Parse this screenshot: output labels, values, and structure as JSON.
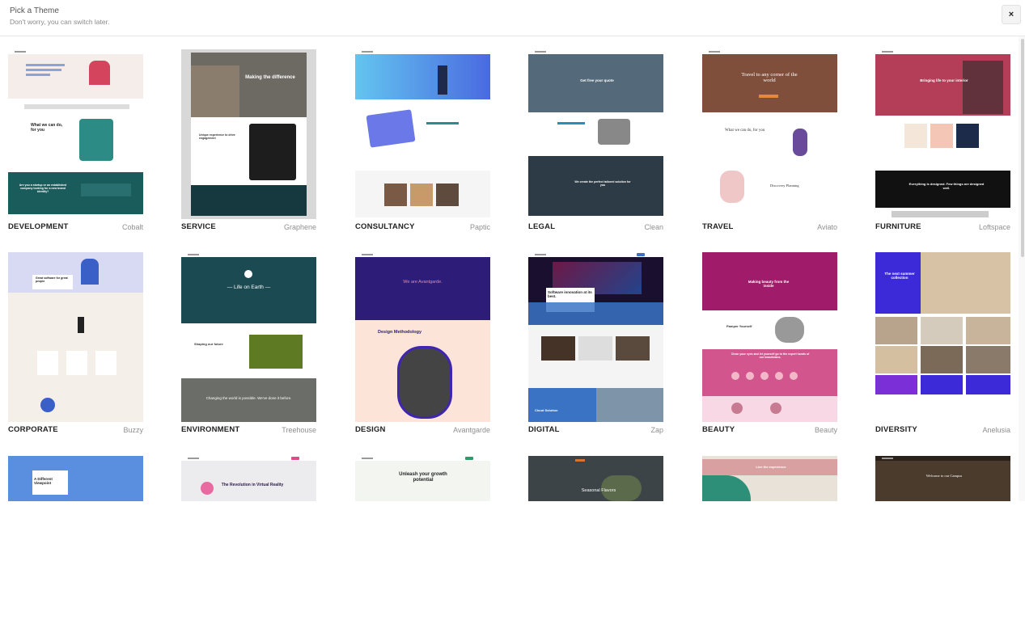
{
  "header": {
    "title": "Pick a Theme",
    "subtitle": "Don't worry, you can switch later.",
    "close_label": "×"
  },
  "themes": [
    {
      "category": "DEVELOPMENT",
      "name": "Cobalt",
      "headline": "What we can do, for you",
      "banner": "Are you a startup or an established company looking for a new brand identity?",
      "accent": "#1a5b5c"
    },
    {
      "category": "SERVICE",
      "name": "Graphene",
      "headline": "Making the difference",
      "banner": "Unique experience to drive engagement",
      "accent": "#16393f"
    },
    {
      "category": "CONSULTANCY",
      "name": "Paptic",
      "headline": "",
      "banner": "",
      "accent": "#3b6ee0"
    },
    {
      "category": "LEGAL",
      "name": "Clean",
      "headline": "Get free your quote",
      "banner": "We create the perfect tailored solution for you",
      "accent": "#2c3b46"
    },
    {
      "category": "TRAVEL",
      "name": "Aviato",
      "headline": "Travel to any corner of the world",
      "banner": "What we can do, for you",
      "banner2": "Discovery Planning",
      "accent": "#e08b3a"
    },
    {
      "category": "FURNITURE",
      "name": "Loftspace",
      "headline": "Bringing life to your interior",
      "banner": "Everything is designed. Few things are designed well.",
      "accent": "#b43d58"
    },
    {
      "category": "CORPORATE",
      "name": "Buzzy",
      "headline": "Great software for great people",
      "banner": "",
      "accent": "#3a5fc7"
    },
    {
      "category": "ENVIRONMENT",
      "name": "Treehouse",
      "headline": "— Life on Earth —",
      "banner": "Shaping our future",
      "banner2": "Changing the world is possible. We've done it before.",
      "accent": "#1c4a52"
    },
    {
      "category": "DESIGN",
      "name": "Avantgarde",
      "headline": "We are Avantgarde.",
      "banner": "Design Methodology",
      "accent": "#2d1d78"
    },
    {
      "category": "DIGITAL",
      "name": "Zap",
      "headline": "Software innovation at its best.",
      "banner": "Cloud Solution",
      "accent": "#3b73c4"
    },
    {
      "category": "BEAUTY",
      "name": "Beauty",
      "headline": "Making beauty from the inside",
      "banner": "Pamper Yourself",
      "banner2": "Clean your eyes and let yourself go to the expert hands of our beauticians.",
      "accent": "#a01b6a"
    },
    {
      "category": "DIVERSITY",
      "name": "Anelusia",
      "headline": "The next summer collection",
      "banner": "",
      "accent": "#3c2ad8"
    },
    {
      "category": "",
      "name": "",
      "headline": "A Different Viewpoint",
      "accent": "#5a8fdf"
    },
    {
      "category": "",
      "name": "",
      "headline": "The Revolution in Virtual Reality",
      "accent": "#d94e8a"
    },
    {
      "category": "",
      "name": "",
      "headline": "Unleash your growth potential",
      "accent": "#2e9b6b"
    },
    {
      "category": "",
      "name": "",
      "headline": "Seasonal Flavors",
      "accent": "#d9742a"
    },
    {
      "category": "",
      "name": "",
      "headline": "Live the experience",
      "accent": "#2d8f78"
    },
    {
      "category": "",
      "name": "",
      "headline": "Welcome to our Campus",
      "accent": "#4a3b2c"
    }
  ]
}
